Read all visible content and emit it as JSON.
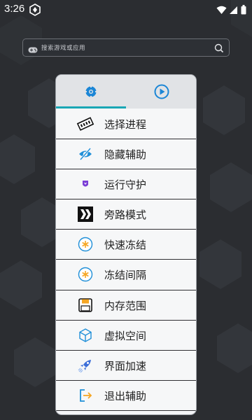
{
  "status": {
    "time": "3:26"
  },
  "search": {
    "placeholder": "搜索游戏或应用"
  },
  "tabs": [
    {
      "icon": "gear-icon"
    },
    {
      "icon": "play-icon"
    }
  ],
  "menu": [
    {
      "label": "选择进程",
      "icon": "memory-chip-icon"
    },
    {
      "label": "隐藏辅助",
      "icon": "eye-off-icon"
    },
    {
      "label": "运行守护",
      "icon": "shield-icon"
    },
    {
      "label": "旁路模式",
      "icon": "chevrons-right-icon"
    },
    {
      "label": "快速冻结",
      "icon": "snowflake-icon"
    },
    {
      "label": "冻结间隔",
      "icon": "snowflake-icon"
    },
    {
      "label": "内存范围",
      "icon": "floppy-disk-icon"
    },
    {
      "label": "虚拟空间",
      "icon": "cube-icon"
    },
    {
      "label": "界面加速",
      "icon": "rocket-icon"
    },
    {
      "label": "退出辅助",
      "icon": "exit-icon"
    }
  ],
  "colors": {
    "accent": "#1aa7b5",
    "background": "#2b2d31",
    "panel": "#f4f5f7"
  }
}
